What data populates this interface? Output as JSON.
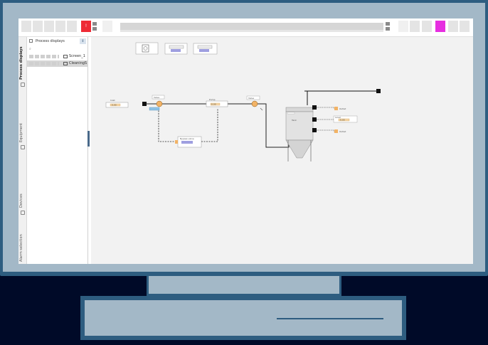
{
  "toolbar": {
    "alarm_label": "!",
    "buttons_left_count": 6,
    "accent_red": "#ee2b36",
    "accent_magenta": "#e62ee0"
  },
  "rail": {
    "tabs": [
      {
        "label": "Process displays",
        "active": true,
        "icon": "process-displays-icon"
      },
      {
        "label": "Equipment",
        "active": false,
        "icon": "equipment-icon"
      },
      {
        "label": "Devices",
        "active": false,
        "icon": "devices-icon"
      },
      {
        "label": "Alarm selection",
        "active": false,
        "icon": "alarm-selection-icon"
      }
    ]
  },
  "panel": {
    "title": "Process displays",
    "pin_label": "⇕",
    "search_symbol": "⌕",
    "items": [
      {
        "label": "Screen_1",
        "selected": false
      },
      {
        "label": "CleaningS",
        "selected": true
      }
    ]
  },
  "canvas": {
    "small_labels": {
      "inlet": "Inlet",
      "valve1": "Valve",
      "valve2": "Valve",
      "pump": "Pump",
      "bypass": "Bypass valve",
      "tank": "Tank",
      "level": "Level",
      "temp": "Temperature",
      "pressure": "Pressure",
      "outlet_1": "Outlet",
      "outlet_2": "Outlet",
      "outlet_3": "Outlet",
      "value_inlet": "0.00",
      "value_pump": "0.00",
      "value_level": "0.00"
    }
  }
}
